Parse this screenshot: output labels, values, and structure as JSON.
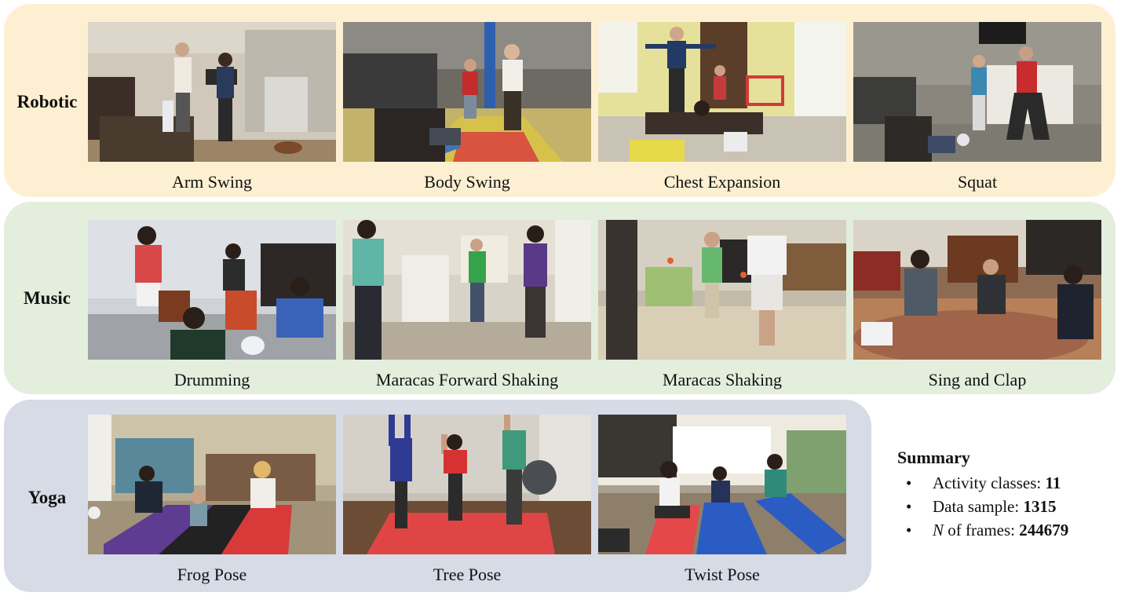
{
  "groups": {
    "robotic": {
      "label": "Robotic",
      "color": "#fdf0d2",
      "activities": [
        "Arm Swing",
        "Body Swing",
        "Chest Expansion",
        "Squat"
      ]
    },
    "music": {
      "label": "Music",
      "color": "#e3eedd",
      "activities": [
        "Drumming",
        "Maracas Forward Shaking",
        "Maracas Shaking",
        "Sing and Clap"
      ]
    },
    "yoga": {
      "label": "Yoga",
      "color": "#d6dbe6",
      "activities": [
        "Frog Pose",
        "Tree Pose",
        "Twist Pose"
      ]
    }
  },
  "summary": {
    "title": "Summary",
    "items": [
      {
        "label": "Activity classes:",
        "value": "11"
      },
      {
        "label": "Data sample:",
        "value": "1315"
      },
      {
        "label_italic": "N",
        "label": " of frames:",
        "value": "244679"
      }
    ]
  }
}
